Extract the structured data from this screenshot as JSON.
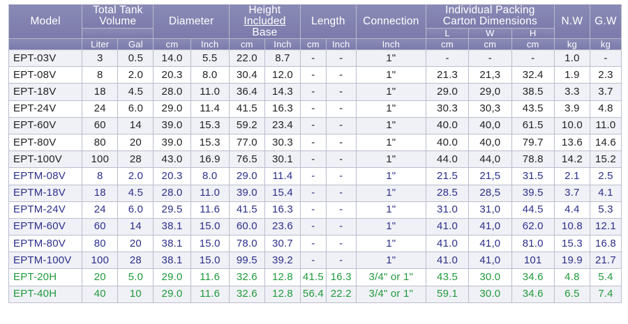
{
  "header": {
    "model": "Model",
    "total_tank_volume": "Total Tank Volume",
    "diameter": "Diameter",
    "height_line1": "Height",
    "height_line2": "Included",
    "height_line3": "Base",
    "length": "Length",
    "connection": "Connection",
    "packing_line1": "Individual Packing",
    "packing_line2": "Carton Dimensions",
    "nw": "N.W",
    "gw": "G.W",
    "pack_l": "L",
    "pack_w": "W",
    "pack_h": "H",
    "units": [
      "Liter",
      "Gal",
      "cm",
      "Inch",
      "cm",
      "Inch",
      "cm",
      "Inch",
      "Inch",
      "cm",
      "cm",
      "cm",
      "kg",
      "kg"
    ]
  },
  "rows": [
    {
      "group": "ept",
      "cells": [
        "EPT-03V",
        "3",
        "0.5",
        "14.0",
        "5.5",
        "22.0",
        "8.7",
        "-",
        "-",
        "1\"",
        "-",
        "-",
        "-",
        "1.0",
        "-"
      ]
    },
    {
      "group": "ept",
      "cells": [
        "EPT-08V",
        "8",
        "2.0",
        "20.3",
        "8.0",
        "30.4",
        "12.0",
        "-",
        "-",
        "1\"",
        "21.3",
        "21,3",
        "32.4",
        "1.9",
        "2.3"
      ]
    },
    {
      "group": "ept",
      "cells": [
        "EPT-18V",
        "18",
        "4.5",
        "28.0",
        "11.0",
        "36.4",
        "14.3",
        "-",
        "-",
        "1\"",
        "29.0",
        "29,0",
        "38.5",
        "3.3",
        "3.7"
      ]
    },
    {
      "group": "ept",
      "cells": [
        "EPT-24V",
        "24",
        "6.0",
        "29.0",
        "11.4",
        "41.5",
        "16.3",
        "-",
        "-",
        "1\"",
        "30.3",
        "30,3",
        "43.5",
        "3.9",
        "4.8"
      ]
    },
    {
      "group": "ept",
      "cells": [
        "EPT-60V",
        "60",
        "14",
        "39.0",
        "15.3",
        "59.2",
        "23.4",
        "-",
        "-",
        "1\"",
        "40.0",
        "40,0",
        "61.5",
        "10.0",
        "11.0"
      ]
    },
    {
      "group": "ept",
      "cells": [
        "EPT-80V",
        "80",
        "20",
        "39.0",
        "15.3",
        "77.0",
        "30.3",
        "-",
        "-",
        "1\"",
        "40.0",
        "40,0",
        "79.7",
        "13.6",
        "14.6"
      ]
    },
    {
      "group": "ept",
      "cells": [
        "EPT-100V",
        "100",
        "28",
        "43.0",
        "16.9",
        "76.5",
        "30.1",
        "-",
        "-",
        "1\"",
        "44.0",
        "44,0",
        "78.8",
        "14.2",
        "15.2"
      ]
    },
    {
      "group": "eptm",
      "cells": [
        "EPTM-08V",
        "8",
        "2.0",
        "20.3",
        "8.0",
        "29.0",
        "11.4",
        "-",
        "-",
        "1\"",
        "21.5",
        "21,5",
        "31.5",
        "2.1",
        "2.5"
      ]
    },
    {
      "group": "eptm",
      "cells": [
        "EPTM-18V",
        "18",
        "4.5",
        "28.0",
        "11.0",
        "39.0",
        "15.4",
        "-",
        "-",
        "1\"",
        "28.5",
        "28,5",
        "39.5",
        "3.7",
        "4.1"
      ]
    },
    {
      "group": "eptm",
      "cells": [
        "EPTM-24V",
        "24",
        "6.0",
        "29.5",
        "11.6",
        "41.5",
        "16.3",
        "-",
        "-",
        "1\"",
        "31.0",
        "31,0",
        "44.5",
        "4.4",
        "5.3"
      ]
    },
    {
      "group": "eptm",
      "cells": [
        "EPTM-60V",
        "60",
        "14",
        "38.1",
        "15.0",
        "60.0",
        "23.6",
        "-",
        "-",
        "1\"",
        "41.0",
        "41,0",
        "62.0",
        "10.8",
        "12.1"
      ]
    },
    {
      "group": "eptm",
      "cells": [
        "EPTM-80V",
        "80",
        "20",
        "38.1",
        "15.0",
        "78.0",
        "30.7",
        "-",
        "-",
        "1\"",
        "41.0",
        "41,0",
        "81.0",
        "15.3",
        "16.8"
      ]
    },
    {
      "group": "eptm",
      "cells": [
        "EPTM-100V",
        "100",
        "28",
        "38.1",
        "15.0",
        "99.5",
        "39.2",
        "-",
        "-",
        "1\"",
        "41.0",
        "41,0",
        "101",
        "19.9",
        "21.7"
      ]
    },
    {
      "group": "h",
      "cells": [
        "EPT-20H",
        "20",
        "5.0",
        "29.0",
        "11.6",
        "32.6",
        "12.8",
        "41.5",
        "16.3",
        "3/4\" or 1\"",
        "43.5",
        "30.0",
        "34.6",
        "4.8",
        "5.4"
      ]
    },
    {
      "group": "h",
      "cells": [
        "EPT-40H",
        "40",
        "10",
        "29.0",
        "11.6",
        "32.6",
        "12.8",
        "56.4",
        "22.2",
        "3/4\" or 1\"",
        "59.1",
        "30.0",
        "34.6",
        "6.5",
        "7.4"
      ]
    }
  ],
  "colors": {
    "header_bg": "#7f7eae",
    "text_ept": "#222222",
    "text_eptm": "#2c2f8a",
    "text_h": "#1f9a3a",
    "row_alt": "#f0f1f6"
  }
}
